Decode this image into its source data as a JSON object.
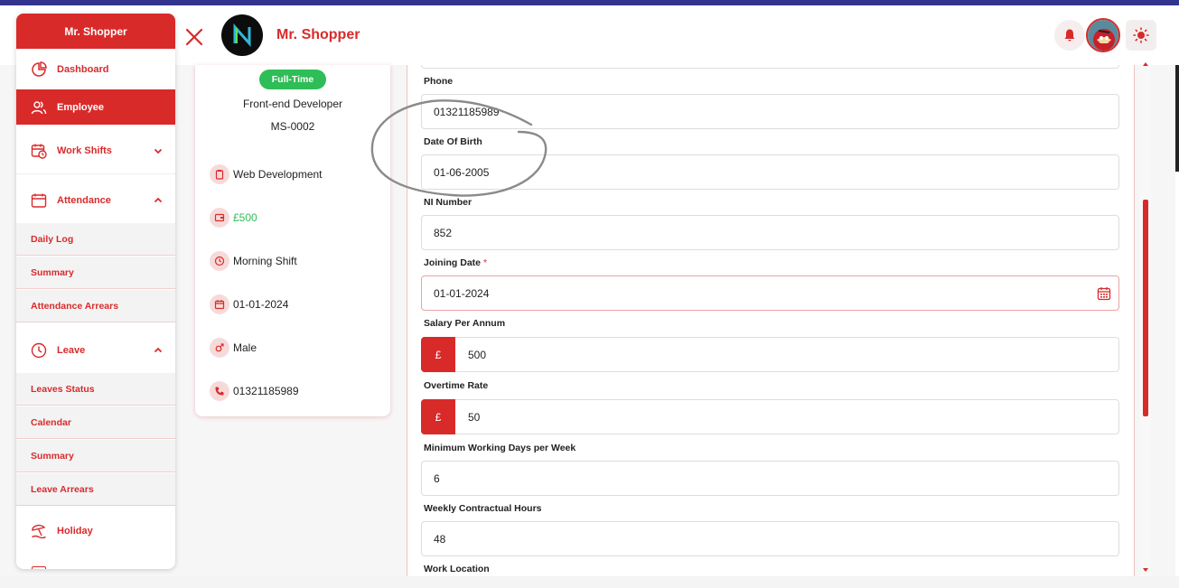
{
  "app": {
    "name": "Mr. Shopper"
  },
  "sidebar": {
    "brand": "Mr. Shopper",
    "items": [
      {
        "label": "Dashboard"
      },
      {
        "label": "Employee"
      },
      {
        "label": "Work Shifts"
      },
      {
        "label": "Attendance"
      },
      {
        "label": "Leave"
      },
      {
        "label": "Holiday"
      }
    ],
    "attendance_sub": [
      "Daily Log",
      "Summary",
      "Attendance Arrears"
    ],
    "leave_sub": [
      "Leaves Status",
      "Calendar",
      "Summary",
      "Leave Arrears"
    ]
  },
  "profile": {
    "badge": "Full-Time",
    "role": "Front-end Developer",
    "id": "MS-0002",
    "details": {
      "department": "Web Development",
      "salary": "£500",
      "shift": "Morning Shift",
      "joining_date": "01-01-2024",
      "gender": "Male",
      "phone": "01321185989"
    }
  },
  "form": {
    "phone": {
      "label": "Phone",
      "value": "01321185989"
    },
    "dob": {
      "label": "Date Of Birth",
      "value": "01-06-2005"
    },
    "ni": {
      "label": "NI Number",
      "value": "852"
    },
    "joining": {
      "label": "Joining Date",
      "required_mark": "*",
      "value": "01-01-2024"
    },
    "salary": {
      "label": "Salary Per Annum",
      "prefix": "£",
      "value": "500"
    },
    "overtime": {
      "label": "Overtime Rate",
      "prefix": "£",
      "value": "50"
    },
    "min_days": {
      "label": "Minimum Working Days per Week",
      "value": "6"
    },
    "weekly_hours": {
      "label": "Weekly Contractual Hours",
      "value": "48"
    },
    "work_location": {
      "label": "Work Location"
    }
  },
  "colors": {
    "primary": "#d92a2a",
    "success": "#2ebd56",
    "topbar": "#33348e"
  }
}
